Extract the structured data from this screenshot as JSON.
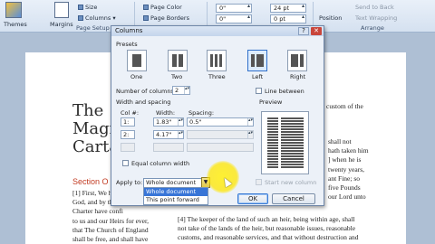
{
  "ribbon": {
    "themes_label": "Themes",
    "margins_label": "Margins",
    "size_label": "Size",
    "columns_label": "Columns",
    "page_color_label": "Page Color",
    "page_borders_label": "Page Borders",
    "page_setup_group": "Page Setup",
    "indent_left": "0\"",
    "indent_right": "0\"",
    "spacing_before": "24 pt",
    "spacing_after": "0 pt",
    "position_label": "Position",
    "send_to_back_label": "Send to Back",
    "text_wrapping_label": "Text Wrapping",
    "arrange_group": "Arrange"
  },
  "document": {
    "title_lines": [
      "The",
      "Magn",
      "Carta"
    ],
    "section_heading": "Section O",
    "left_lines": [
      "[1] First, We have",
      "God, and by this pr",
      "Charter have confi",
      "to us and our Heirs for ever,",
      "that The Church of England",
      "shall be free, and shall have"
    ],
    "right_lines": [
      "custom of the",
      "shall not",
      "hath taken him",
      "] when he is",
      "twenty years,",
      "ant Fine; so",
      "five Pounds",
      "our Lord unto"
    ],
    "para4_lines": [
      "[4] The keeper of the land of such an heir, being within age, shall",
      "not take of the lands of the heir, but reasonable issues, reasonable",
      "customs, and reasonable services, and that without destruction and"
    ]
  },
  "dialog": {
    "title": "Columns",
    "help": "?",
    "close": "✕",
    "presets_label": "Presets",
    "presets": [
      "One",
      "Two",
      "Three",
      "Left",
      "Right"
    ],
    "num_columns_label": "Number of columns:",
    "num_columns": "2",
    "line_between_label": "Line between",
    "width_spacing_label": "Width and spacing",
    "preview_label": "Preview",
    "col_header": "Col #:",
    "width_header": "Width:",
    "spacing_header": "Spacing:",
    "rows": [
      {
        "col": "1:",
        "width": "1.83\"",
        "spacing": "0.5\""
      },
      {
        "col": "2:",
        "width": "4.17\"",
        "spacing": ""
      }
    ],
    "equal_width_label": "Equal column width",
    "apply_to_label": "Apply to:",
    "apply_to_value": "Whole document",
    "apply_options": [
      "Whole document",
      "This point forward"
    ],
    "start_new_column_label": "Start new column",
    "ok_label": "OK",
    "cancel_label": "Cancel"
  }
}
